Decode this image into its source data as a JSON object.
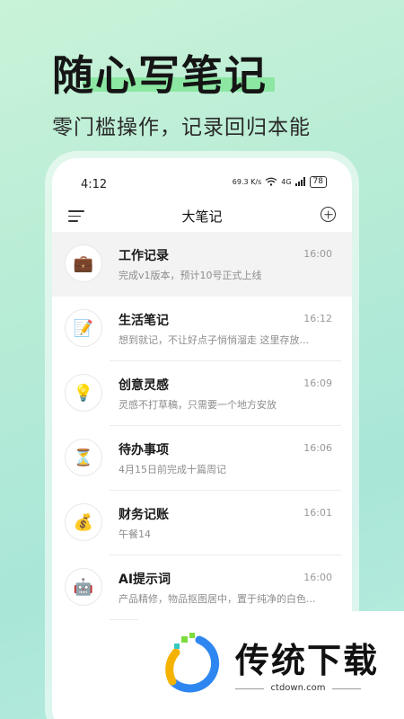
{
  "promo": {
    "headline": "随心写笔记",
    "subline": "零门槛操作，记录回归本能"
  },
  "statusbar": {
    "time": "4:12",
    "net_speed": "69.3 K/s",
    "signal": "4G",
    "battery": "78"
  },
  "appbar": {
    "title": "大笔记"
  },
  "notes": [
    {
      "icon": "briefcase-icon",
      "glyph": "💼",
      "title": "工作记录",
      "time": "16:00",
      "preview": "完成v1版本，预计10号正式上线"
    },
    {
      "icon": "notepad-icon",
      "glyph": "📝",
      "title": "生活笔记",
      "time": "16:12",
      "preview": "想到就记，不让好点子悄悄溜走 这里存放..."
    },
    {
      "icon": "lightbulb-icon",
      "glyph": "💡",
      "title": "创意灵感",
      "time": "16:09",
      "preview": "灵感不打草稿，只需要一个地方安放"
    },
    {
      "icon": "hourglass-icon",
      "glyph": "⏳",
      "title": "待办事项",
      "time": "16:06",
      "preview": "4月15日前完成十篇周记"
    },
    {
      "icon": "moneybag-icon",
      "glyph": "💰",
      "title": "财务记账",
      "time": "16:01",
      "preview": "午餐14"
    },
    {
      "icon": "robot-icon",
      "glyph": "🤖",
      "title": "AI提示词",
      "time": "16:00",
      "preview": "产品精修，物品抠图居中，置于纯净的白色..."
    }
  ],
  "watermark": {
    "name": "传统下载",
    "url": "ctdown.com"
  },
  "colors": {
    "background": "#b8ecd6",
    "highlight": "#8be7a2",
    "card": "#ffffff"
  }
}
